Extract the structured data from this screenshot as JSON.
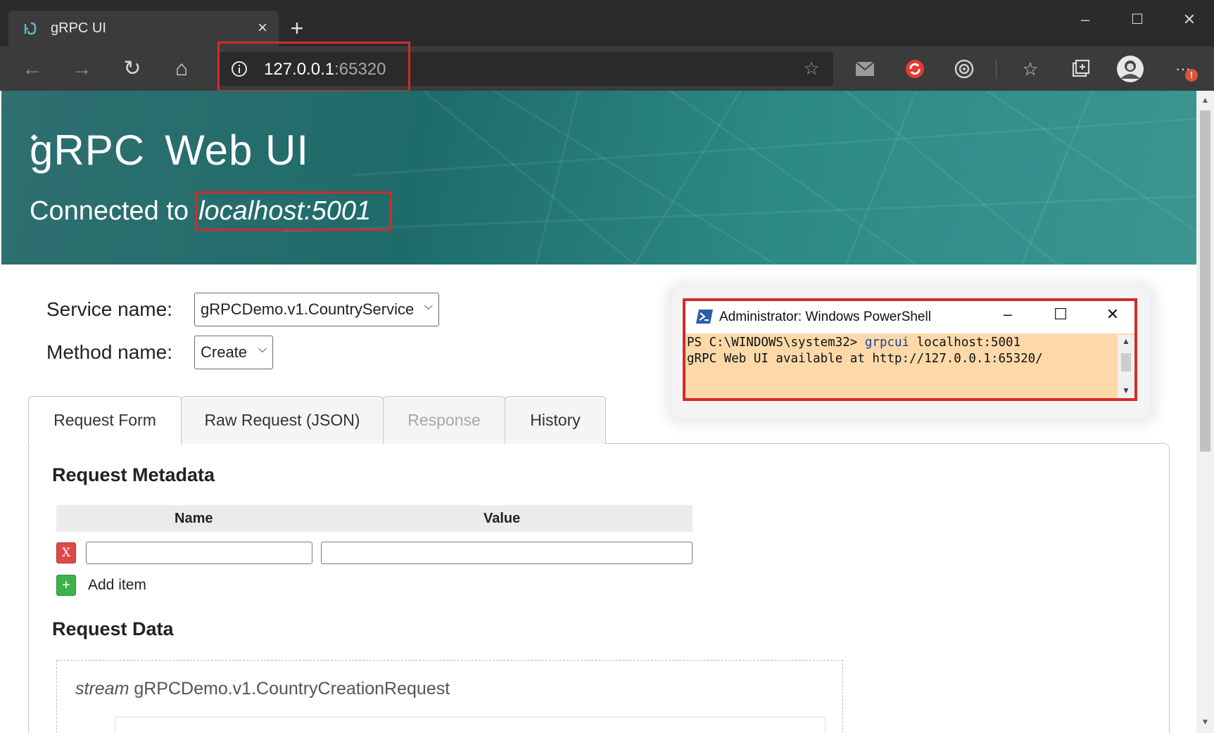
{
  "browser": {
    "tab_title": "gRPC UI",
    "tab_close": "×",
    "new_tab": "+",
    "address_host": "127.0.0.1",
    "address_port": ":65320",
    "window_controls": [
      "–",
      "☐",
      "✕"
    ],
    "nav": {
      "back": "←",
      "forward": "→",
      "refresh": "↻",
      "home": "⌂"
    },
    "menu": "···",
    "notification_count": "!"
  },
  "header": {
    "brand_grpc": "gRPC",
    "brand_webui": "Web UI",
    "connected_label": "Connected to",
    "connected_host": "localhost:5001"
  },
  "form": {
    "service_label": "Service name:",
    "service_value": "gRPCDemo.v1.CountryService",
    "method_label": "Method name:",
    "method_value": "Create"
  },
  "powershell": {
    "title": "Administrator: Windows PowerShell",
    "line1_prompt": "PS C:\\WINDOWS\\system32> ",
    "line1_cmd": "grpcui",
    "line1_args": " localhost:5001",
    "line2": "gRPC Web UI available at http://127.0.0.1:65320/"
  },
  "tabs": [
    {
      "label": "Request Form",
      "state": "active"
    },
    {
      "label": "Raw Request (JSON)",
      "state": "normal"
    },
    {
      "label": "Response",
      "state": "disabled"
    },
    {
      "label": "History",
      "state": "normal"
    }
  ],
  "metadata": {
    "title": "Request Metadata",
    "col_name": "Name",
    "col_value": "Value",
    "remove_label": "X",
    "add_symbol": "+",
    "add_label": "Add item"
  },
  "request_data": {
    "title": "Request Data",
    "stream_keyword": "stream",
    "message_type": " gRPCDemo.v1.CountryCreationRequest"
  },
  "colors": {
    "highlight": "#d32a2a",
    "banner": "#1e6c6a",
    "powershell_bg": "#fdd9a9"
  }
}
